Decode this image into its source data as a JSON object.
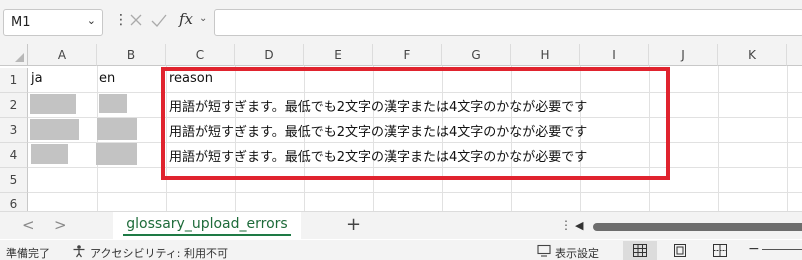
{
  "formula_bar": {
    "name_box": "M1",
    "fx_label": "fx",
    "formula": ""
  },
  "columns": [
    "A",
    "B",
    "C",
    "D",
    "E",
    "F",
    "G",
    "H",
    "I",
    "J",
    "K"
  ],
  "rows": [
    "1",
    "2",
    "3",
    "4",
    "5",
    "6"
  ],
  "cells": {
    "a1": "ja",
    "b1": "en",
    "c1": "reason",
    "c2": "用語が短すぎます。最低でも2文字の漢字または4文字のかなが必要です",
    "c3": "用語が短すぎます。最低でも2文字の漢字または4文字のかなが必要です",
    "c4": "用語が短すぎます。最低でも2文字の漢字または4文字のかなが必要です"
  },
  "highlight_color": "#e0232e",
  "sheet_tabs": {
    "active": "glossary_upload_errors",
    "add": "+",
    "prev": "<",
    "next": ">",
    "more": "⋮"
  },
  "status_bar": {
    "ready": "準備完了",
    "accessibility": "アクセシビリティ: 利用不可",
    "display_settings": "表示設定",
    "zoom_out": "−"
  },
  "icons": [
    "chevron-down-icon",
    "cancel-icon",
    "check-icon",
    "accessibility-icon",
    "display-settings-icon",
    "normal-view-icon",
    "page-layout-icon",
    "page-break-icon"
  ]
}
